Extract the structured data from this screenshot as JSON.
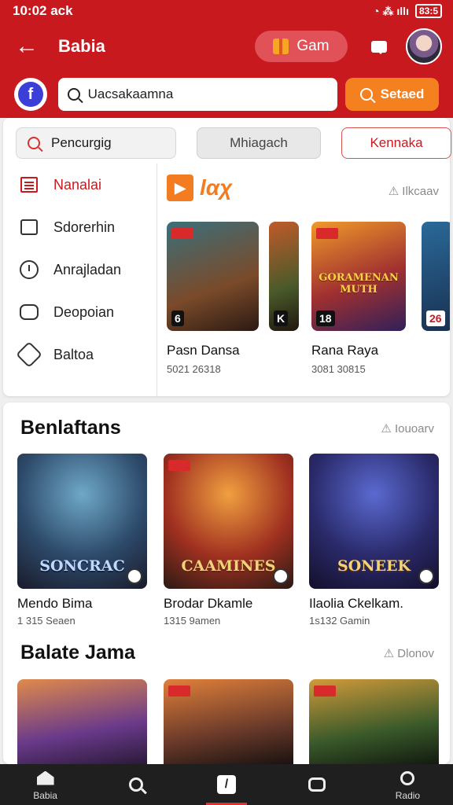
{
  "status_bar": {
    "time": "10:02 ack",
    "icons": "◔ ⁂ ıllı",
    "battery": "83:5"
  },
  "app_bar": {
    "title": "Babia",
    "gam_label": "Gam"
  },
  "search_row": {
    "fb_letter": "f",
    "search_value": "Uacsakaamna",
    "search_button": "Setaed"
  },
  "filters": [
    {
      "label": "Pencurgig"
    },
    {
      "label": "Mhiagach"
    },
    {
      "label": "Kennaka"
    }
  ],
  "sidebar": {
    "items": [
      {
        "label": "Nanalai",
        "icon": "list-icon"
      },
      {
        "label": "Sdorerhin",
        "icon": "box-icon"
      },
      {
        "label": "Anrajladan",
        "icon": "clock-icon"
      },
      {
        "label": "Deopoian",
        "icon": "chat-icon"
      },
      {
        "label": "Baltoa",
        "icon": "gear-icon"
      }
    ]
  },
  "recommended": {
    "logo_text": "lαχ",
    "see_all": "⚠ Ilkcaav",
    "tiles": [
      {
        "title": "Pasn Dansa",
        "meta": "5021 26318",
        "badge": "6"
      },
      {
        "title": "",
        "meta": "",
        "badge": "K"
      },
      {
        "title": "Rana Raya",
        "meta": "3081 30815",
        "badge": "18",
        "art_text": "GORAMENAN MUTH"
      },
      {
        "title": "",
        "meta": "",
        "badge": "26"
      }
    ]
  },
  "section1": {
    "title": "Benlaftans",
    "see_all": "⚠ Iouoarv",
    "games": [
      {
        "title": "Mendo Bima",
        "meta": "1 315 Seaen",
        "art_text": "SONCRAC"
      },
      {
        "title": "Brodar Dkamle",
        "meta": "1315 9amen",
        "art_text": "CAAMINES"
      },
      {
        "title": "Ilaolia Ckelkam.",
        "meta": "1s132 Gamin",
        "art_text": "SONEEK"
      }
    ]
  },
  "section2": {
    "title": "Balate Jama",
    "see_all": "⚠ Dlonov",
    "games": [
      {
        "art_text": ""
      },
      {
        "art_text": ""
      },
      {
        "art_text": ""
      }
    ]
  },
  "tabbar": {
    "tabs": [
      {
        "label": "Babia",
        "icon": "home-icon"
      },
      {
        "label": "",
        "icon": "search-icon"
      },
      {
        "label": "",
        "icon": "gamepad-icon"
      },
      {
        "label": "",
        "icon": "game-icon"
      },
      {
        "label": "Radio",
        "icon": "profile-icon"
      }
    ]
  },
  "colors": {
    "brand_red": "#c8191e",
    "accent_orange": "#f58020"
  }
}
